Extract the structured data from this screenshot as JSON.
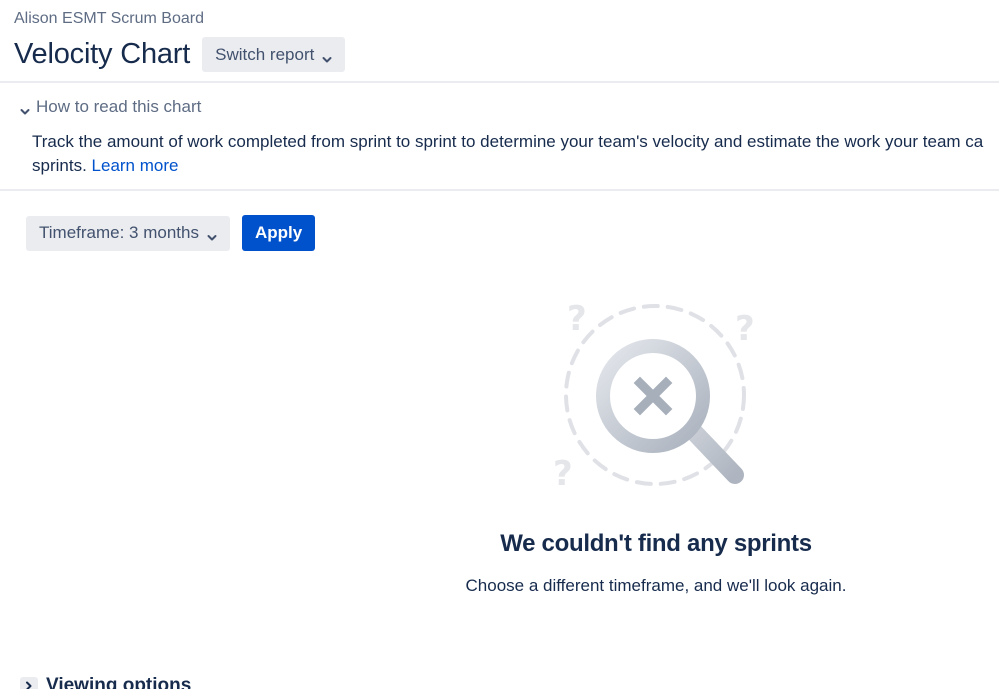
{
  "breadcrumb": "Alison ESMT Scrum Board",
  "page_title": "Velocity Chart",
  "switch_report": {
    "label": "Switch report",
    "icon": "chevron-down-icon"
  },
  "how_to_read": {
    "label": "How to read this chart",
    "icon": "chevron-down-icon",
    "description_line1": "Track the amount of work completed from sprint to sprint to determine your team's velocity and estimate the work your team ca",
    "description_line2": "sprints.",
    "learn_more": "Learn more"
  },
  "filters": {
    "timeframe_label": "Timeframe: 3 months",
    "apply_label": "Apply"
  },
  "empty_state": {
    "illustration": "magnifier-x-icon",
    "title": "We couldn't find any sprints",
    "subtitle": "Choose a different timeframe, and we'll look again."
  },
  "viewing_options": {
    "label": "Viewing options",
    "icon": "chevron-right-icon"
  },
  "colors": {
    "primary": "#0052CC",
    "text": "#172B4D",
    "subtle_text": "#5E6C84",
    "neutral_bg": "#EBECF0",
    "link": "#0052CC"
  }
}
